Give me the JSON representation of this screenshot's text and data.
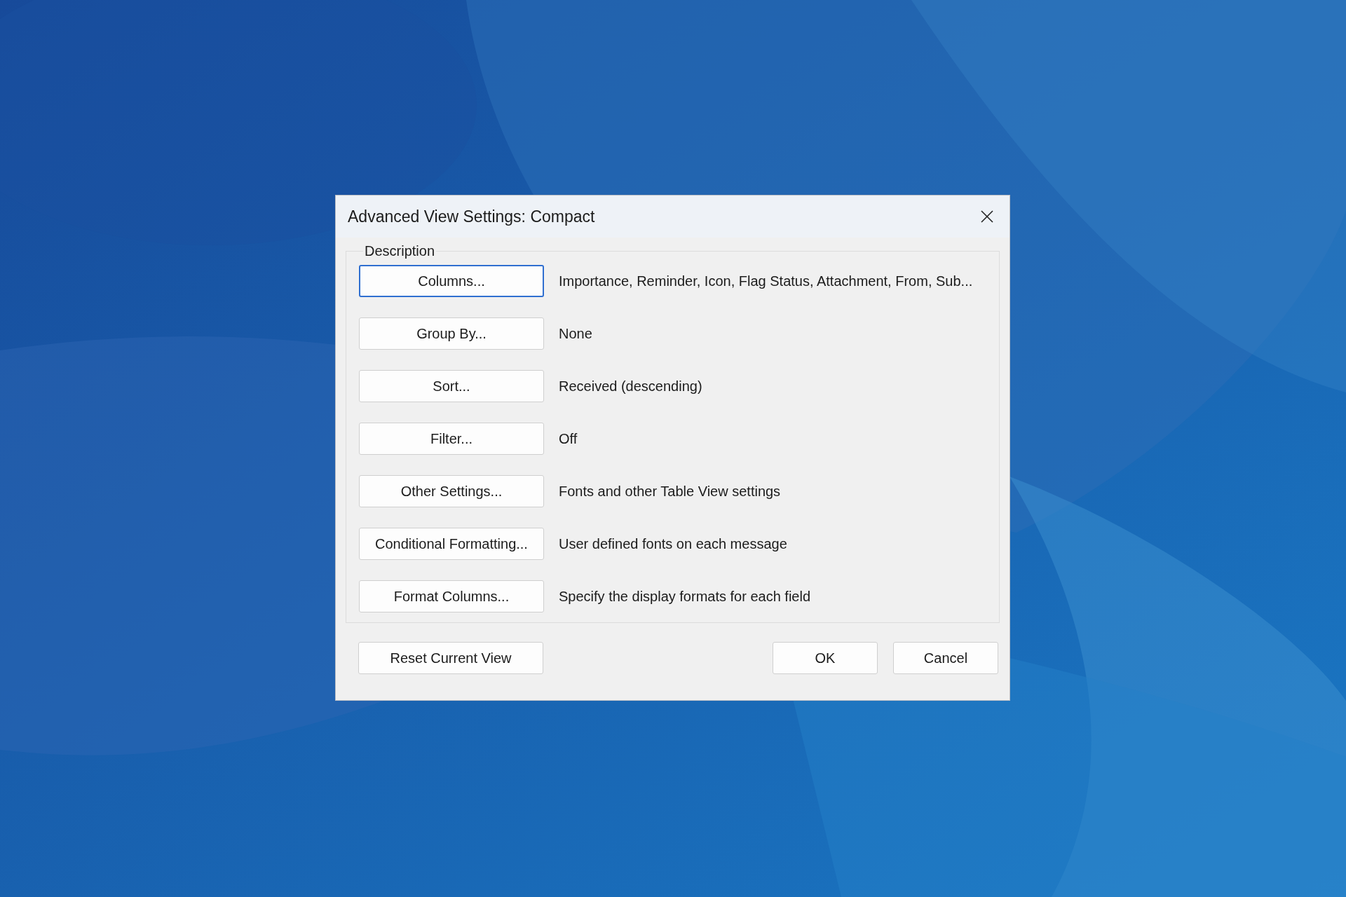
{
  "window": {
    "title": "Advanced View Settings: Compact"
  },
  "group": {
    "label": "Description",
    "rows": [
      {
        "button": "Columns...",
        "description": "Importance, Reminder, Icon, Flag Status, Attachment, From, Sub...",
        "focused": true
      },
      {
        "button": "Group By...",
        "description": "None",
        "focused": false
      },
      {
        "button": "Sort...",
        "description": "Received (descending)",
        "focused": false
      },
      {
        "button": "Filter...",
        "description": "Off",
        "focused": false
      },
      {
        "button": "Other Settings...",
        "description": "Fonts and other Table View settings",
        "focused": false
      },
      {
        "button": "Conditional Formatting...",
        "description": "User defined fonts on each message",
        "focused": false
      },
      {
        "button": "Format Columns...",
        "description": "Specify the display formats for each field",
        "focused": false
      }
    ]
  },
  "footer": {
    "reset": "Reset Current View",
    "buttons": [
      "OK",
      "Cancel"
    ]
  }
}
